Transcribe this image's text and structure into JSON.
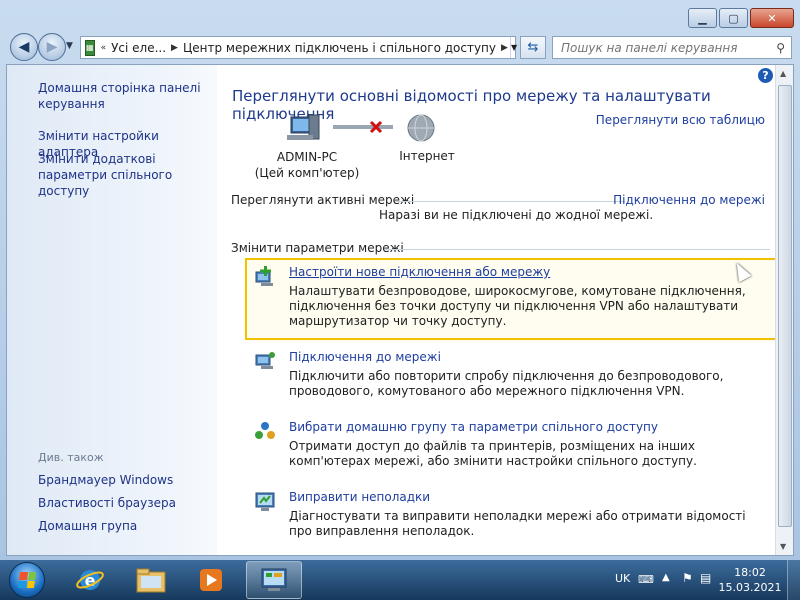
{
  "address": {
    "segments": [
      "Усі еле...",
      "Центр мережних підключень і спільного доступу"
    ],
    "search_placeholder": "Пошук на панелі керування"
  },
  "sidebar": {
    "items": [
      "Домашня сторінка панелі керування",
      "Змінити настройки адаптера",
      "Змінити додаткові параметри спільного доступу"
    ],
    "see_also_heading": "Див. також",
    "see_also": [
      "Брандмауер Windows",
      "Властивості браузера",
      "Домашня група"
    ]
  },
  "main": {
    "title": "Переглянути основні відомості про мережу та налаштувати підключення",
    "view_full_map": "Переглянути всю таблицю",
    "computer_name": "ADMIN-PC",
    "computer_sub": "(Цей комп'ютер)",
    "internet_label": "Інтернет",
    "active_networks_title": "Переглянути активні мережі",
    "connect_link": "Підключення до мережі",
    "not_connected": "Наразі ви не підключені до жодної мережі.",
    "change_settings_title": "Змінити параметри мережі",
    "tasks": [
      {
        "link": "Настроїти нове підключення або мережу",
        "desc": "Налаштувати безпроводове, широкосмугове, комутоване підключення, підключення без точки доступу чи підключення VPN або налаштувати маршрутизатор чи точку доступу."
      },
      {
        "link": "Підключення до мережі",
        "desc": "Підключити або повторити спробу підключення до безпроводового, проводового, комутованого або мережного підключення VPN."
      },
      {
        "link": "Вибрати домашню групу та параметри спільного доступу",
        "desc": "Отримати доступ до файлів та принтерів, розміщених на інших комп'ютерах мережі, або змінити настройки спільного доступу."
      },
      {
        "link": "Виправити неполадки",
        "desc": "Діагностувати та виправити неполадки мережі або отримати відомості про виправлення неполадок."
      }
    ]
  },
  "taskbar": {
    "language": "UK",
    "time": "18:02",
    "date": "15.03.2021"
  },
  "colors": {
    "link": "#1e3ea0",
    "highlight_border": "#f2c200",
    "title": "#1e3a8c"
  }
}
